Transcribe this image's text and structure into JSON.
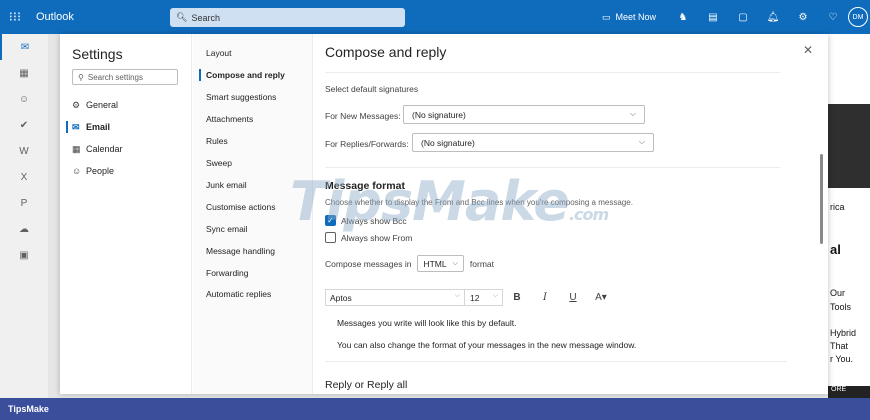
{
  "topbar": {
    "app_name": "Outlook",
    "search_placeholder": "Search",
    "meet_now": "Meet Now",
    "avatar_initials": "DM"
  },
  "settings": {
    "title": "Settings",
    "search_placeholder": "Search settings",
    "categories": [
      {
        "label": "General",
        "icon": "gear-icon",
        "glyph": "⚙"
      },
      {
        "label": "Email",
        "icon": "mail-icon",
        "glyph": "✉"
      },
      {
        "label": "Calendar",
        "icon": "calendar-icon",
        "glyph": "▦"
      },
      {
        "label": "People",
        "icon": "people-icon",
        "glyph": "☺"
      }
    ],
    "active_category": "Email",
    "email_sections": [
      "Layout",
      "Compose and reply",
      "Smart suggestions",
      "Attachments",
      "Rules",
      "Sweep",
      "Junk email",
      "Customise actions",
      "Sync email",
      "Message handling",
      "Forwarding",
      "Automatic replies"
    ],
    "active_section": "Compose and reply"
  },
  "compose": {
    "title": "Compose and reply",
    "signatures_heading": "Select default signatures",
    "new_messages_label": "For New Messages:",
    "new_messages_value": "(No signature)",
    "replies_label": "For Replies/Forwards:",
    "replies_value": "(No signature)",
    "format_heading": "Message format",
    "format_hint": "Choose whether to display the From and Bcc lines when you're composing a message.",
    "always_show_bcc": "Always show Bcc",
    "always_show_bcc_checked": true,
    "always_show_from": "Always show From",
    "always_show_from_checked": false,
    "compose_in_prefix": "Compose messages in",
    "compose_in_value": "HTML",
    "compose_in_suffix": "format",
    "font_name": "Aptos",
    "font_size": "12",
    "preview_line1": "Messages you write will look like this by default.",
    "preview_line2": "You can also change the format of your messages in the new message window.",
    "reply_heading": "Reply or Reply all"
  },
  "background_right": {
    "line1": "rica",
    "line2": "al",
    "line3": "Our",
    "line4": "Tools",
    "line5": "Hybrid",
    "line6": "That",
    "line7": "r You.",
    "button": "ORE"
  },
  "watermark": {
    "main": "TipsMake",
    "suffix": ".com"
  },
  "footer": {
    "brand": "TipsMake"
  },
  "colors": {
    "accent": "#0f6cbd",
    "footer": "#3a4e9c"
  }
}
